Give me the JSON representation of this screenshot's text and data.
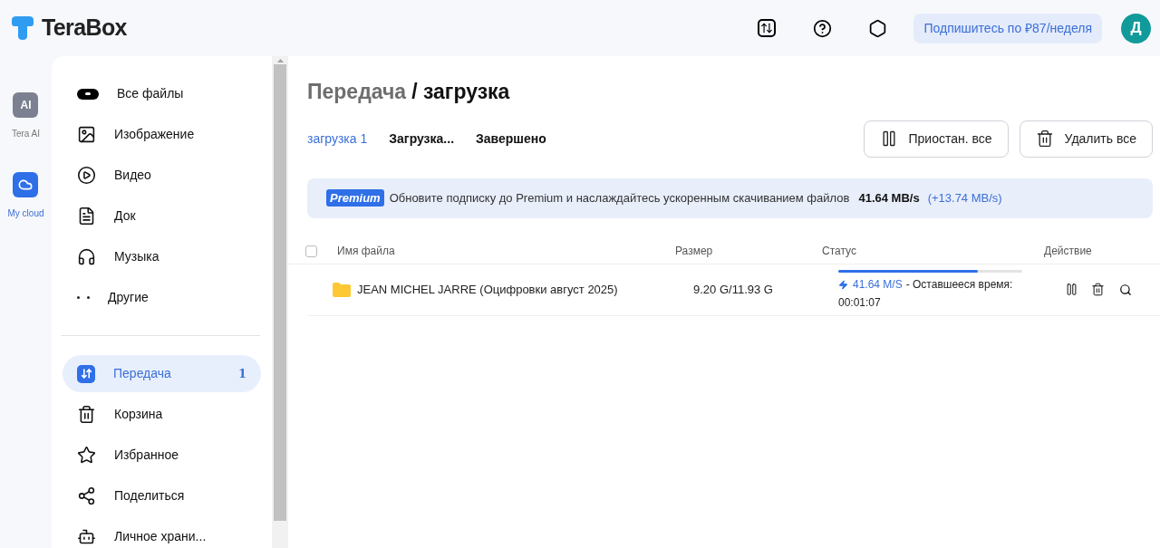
{
  "logo": {
    "text": "TeraBox"
  },
  "header": {
    "subscribe_button": "Подпишитесь по ₽87/неделя",
    "avatar": "Д"
  },
  "rail": [
    {
      "label": "Tera AI",
      "badge": "AI",
      "selected": false
    },
    {
      "label": "My cloud",
      "selected": true
    }
  ],
  "sidebar": {
    "groups": [
      [
        {
          "label": "Все файлы",
          "selected": false
        },
        {
          "label": "Изображение",
          "selected": false
        },
        {
          "label": "Видео",
          "selected": false
        },
        {
          "label": "Док",
          "selected": false
        },
        {
          "label": "Музыка",
          "selected": false
        },
        {
          "label": "Другие",
          "selected": false
        }
      ],
      [
        {
          "label": "Передача",
          "count": "1",
          "selected": true
        },
        {
          "label": "Корзина",
          "selected": false
        },
        {
          "label": "Избранное",
          "selected": false
        },
        {
          "label": "Поделиться",
          "selected": false
        },
        {
          "label": "Личное храни...",
          "selected": false
        }
      ]
    ]
  },
  "breadcrumb": [
    {
      "label": "Передача",
      "current": false
    },
    {
      "label": "/ загрузка",
      "current": true
    }
  ],
  "tabs": [
    {
      "label": "загрузка 1",
      "selected": true
    },
    {
      "label": "Загрузка...",
      "selected": false
    },
    {
      "label": "Завершено",
      "selected": false
    }
  ],
  "toolbar_buttons": [
    "Приостан. все",
    "Удалить все"
  ],
  "banner": {
    "badge": "Premium",
    "text": "Обновите подписку до Premium и наслаждайтесь ускоренным скачиванием файлов",
    "speed": "41.64 MB/s",
    "boost": "(+13.74 MB/s)"
  },
  "table": {
    "select_all_checked": false,
    "columns": [
      "Имя файла",
      "Размер",
      "Статус",
      "Действие"
    ],
    "rows": [
      {
        "name": "JEAN MICHEL JARRE (Оцифровки август 2025)",
        "size": "9.20 G/11.93 G",
        "level": 0.76,
        "speed": "41.64 M/S",
        "remaining": "- Оставшееся время:",
        "time": "00:01:07",
        "checked": false
      }
    ]
  }
}
